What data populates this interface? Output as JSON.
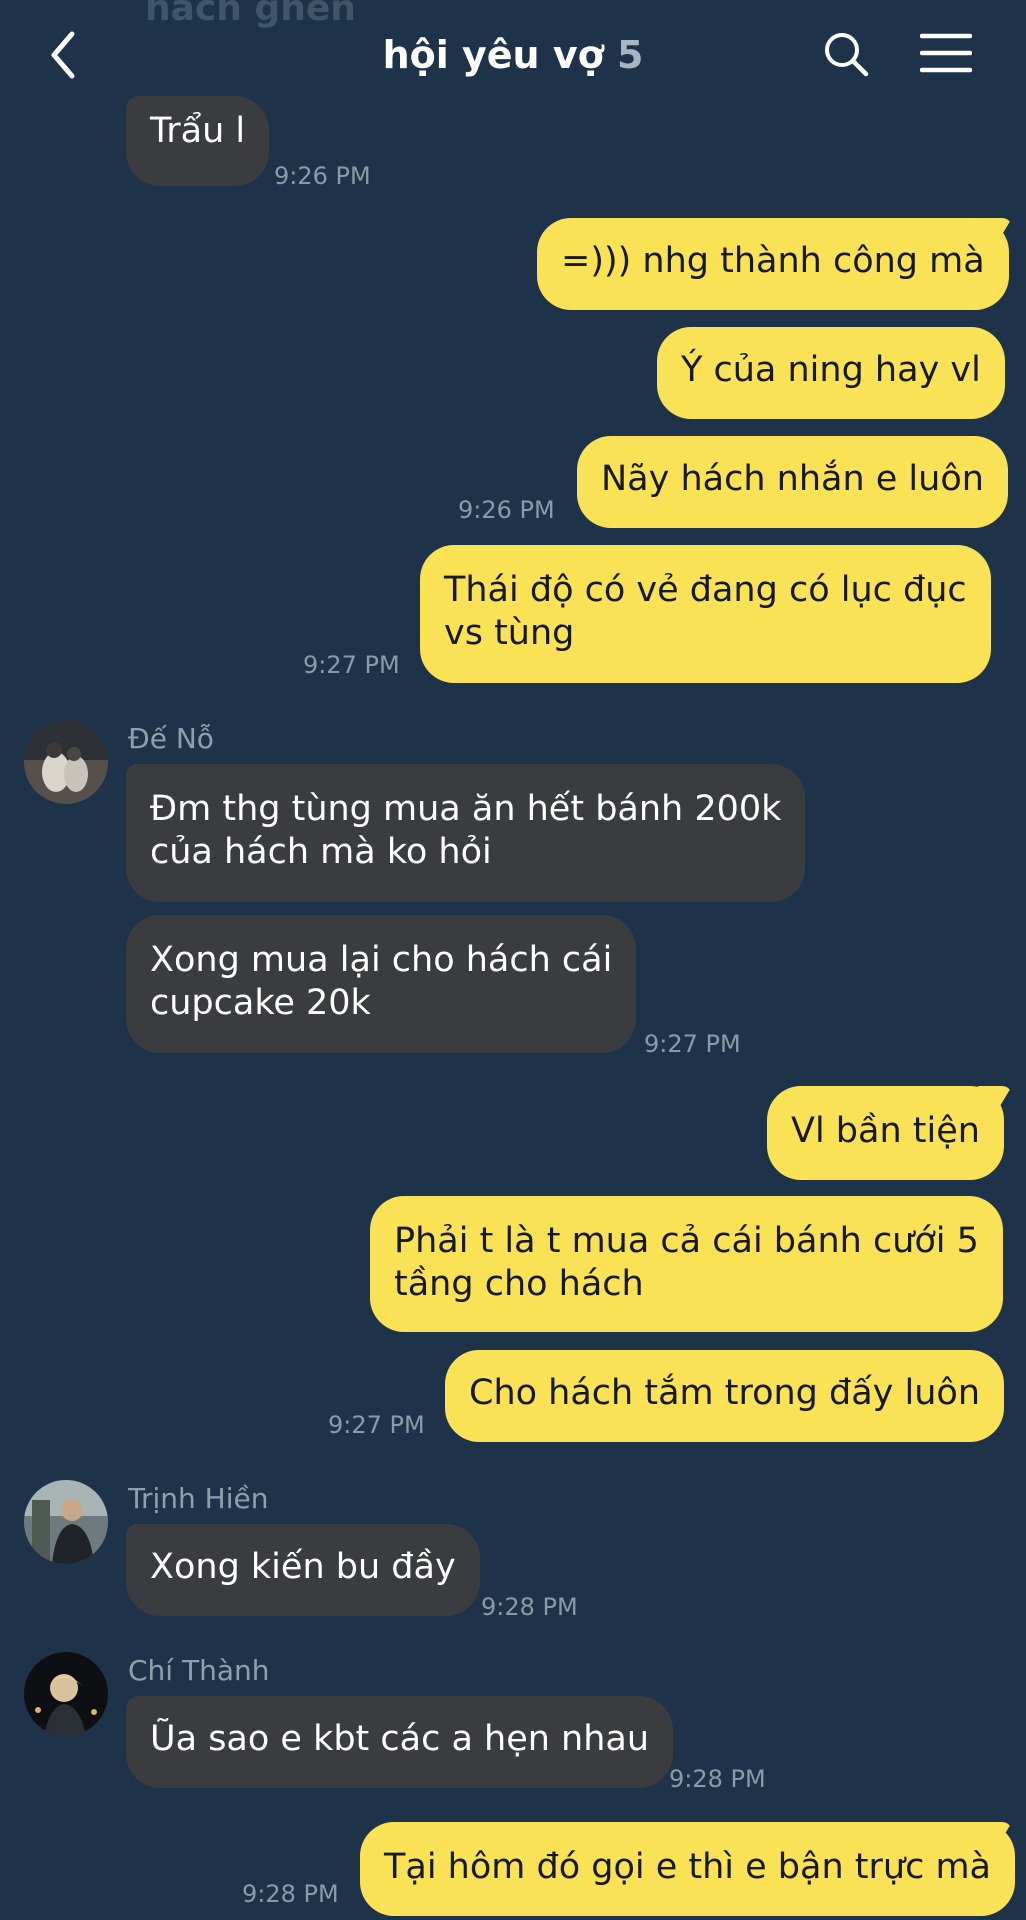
{
  "header": {
    "title": "hội yêu vợ",
    "member_count": "5",
    "ghost_text": "hách ghen",
    "back_icon": "chevron-left-icon",
    "search_icon": "search-icon",
    "menu_icon": "hamburger-menu-icon"
  },
  "colors": {
    "background": "#1e3349",
    "incoming_bubble": "#3a3c3f",
    "outgoing_bubble": "#f9e256",
    "timestamp": "#8b9aa8"
  },
  "messages": [
    {
      "dir": "in",
      "text": "Trẩu l",
      "time": "9:26 PM"
    },
    {
      "dir": "out",
      "text": "=))) nhg thành công mà"
    },
    {
      "dir": "out",
      "text": "Ý của ning hay vl"
    },
    {
      "dir": "out",
      "text": "Nãy hách nhắn e luôn",
      "time": "9:26 PM"
    },
    {
      "dir": "out",
      "text_line1": "Thái độ có vẻ đang có lục đục",
      "text_line2": "vs tùng",
      "time": "9:27 PM"
    },
    {
      "dir": "in",
      "sender": "Đế Nỗ",
      "text_line1": "Đm thg tùng mua ăn hết bánh 200k",
      "text_line2": "của hách mà ko hỏi"
    },
    {
      "dir": "in",
      "text_line1": "Xong mua lại cho hách cái",
      "text_line2": "cupcake 20k",
      "time": "9:27 PM"
    },
    {
      "dir": "out",
      "text": "Vl bần tiện"
    },
    {
      "dir": "out",
      "text_line1": "Phải t là t mua cả cái bánh cưới 5",
      "text_line2": "tầng cho hách"
    },
    {
      "dir": "out",
      "text": "Cho hách tắm trong đấy luôn",
      "time": "9:27 PM"
    },
    {
      "dir": "in",
      "sender": "Trịnh Hiền",
      "text": "Xong kiến bu đầy",
      "time": "9:28 PM"
    },
    {
      "dir": "in",
      "sender": "Chí Thành",
      "text": "Ũa sao e kbt các a hẹn nhau",
      "time": "9:28 PM"
    },
    {
      "dir": "out",
      "text": "Tại hôm đó gọi e thì e bận trực mà",
      "time": "9:28 PM"
    }
  ]
}
